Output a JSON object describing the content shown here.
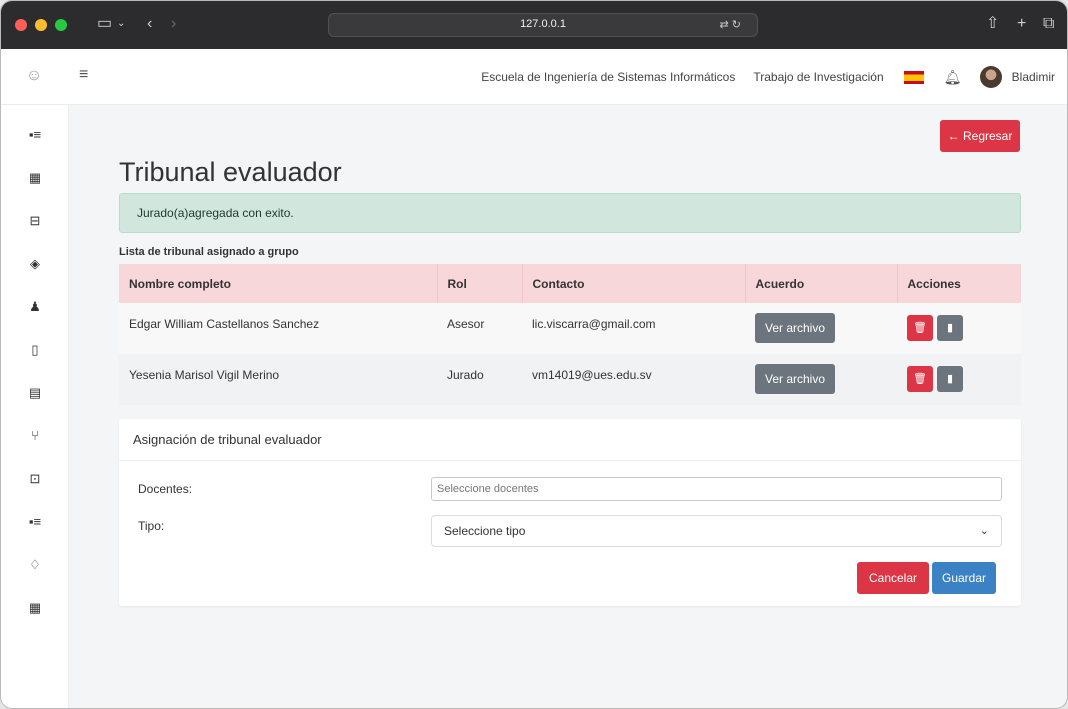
{
  "browser": {
    "url": "127.0.0.1",
    "translate_icon": "translate-icon"
  },
  "header": {
    "school": "Escuela de Ingeniería de Sistemas Informáticos",
    "research": "Trabajo de Investigación",
    "user_name": "Bladimir",
    "flag": "spain-flag-icon",
    "bell": "bell-icon"
  },
  "main": {
    "back_button": "← Regresar",
    "title": "Tribunal evaluador",
    "alert": "Jurado(a)agregada con exito.",
    "list_caption": "Lista de tribunal asignado a grupo",
    "table": {
      "headers": [
        "Nombre completo",
        "Rol",
        "Contacto",
        "Acuerdo",
        "Acciones"
      ],
      "rows": [
        {
          "name": "Edgar William Castellanos Sanchez",
          "role": "Asesor",
          "contact": "lic.viscarra@gmail.com",
          "file_button": "Ver archivo"
        },
        {
          "name": "Yesenia Marisol Vigil Merino",
          "role": "Jurado",
          "contact": "vm14019@ues.edu.sv",
          "file_button": "Ver archivo"
        }
      ]
    }
  },
  "form": {
    "title": "Asignación de tribunal evaluador",
    "docentes_label": "Docentes:",
    "docentes_placeholder": "Seleccione docentes",
    "tipo_label": "Tipo:",
    "tipo_value": "Seleccione tipo",
    "cancel": "Cancelar",
    "save": "Guardar"
  },
  "colors": {
    "danger": "#dc3545",
    "secondary": "#6c757d",
    "primary": "#3b82c4",
    "success_bg": "#d1e7dd",
    "table_header_bg": "#f8d7da"
  }
}
